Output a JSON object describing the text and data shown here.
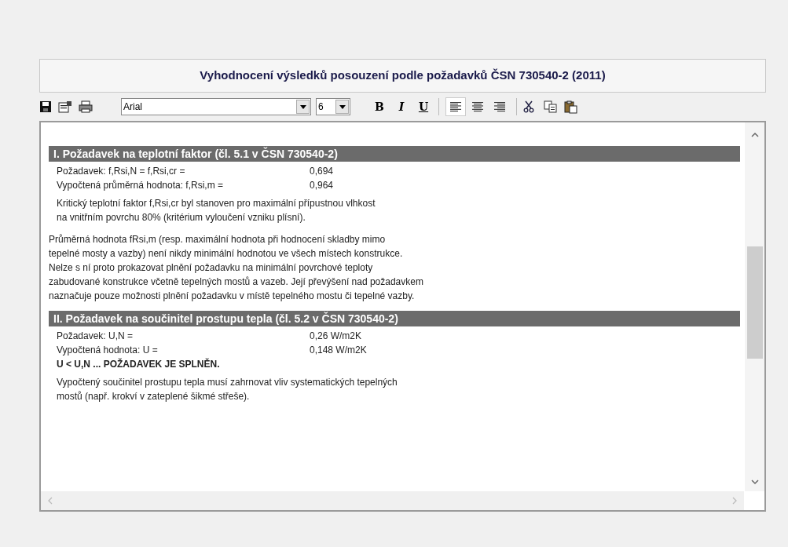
{
  "title": "Vyhodnocení výsledků posouzení podle požadavků ČSN 730540-2 (2011)",
  "toolbar": {
    "font": "Arial",
    "size": "6",
    "formatting": [
      {
        "label": "B",
        "kind": "bold",
        "on": false
      },
      {
        "label": "I",
        "kind": "italic",
        "on": false
      },
      {
        "label": "U",
        "kind": "underline",
        "on": false
      }
    ],
    "alignment": [
      {
        "kind": "left",
        "selected": true
      },
      {
        "kind": "center",
        "selected": false
      },
      {
        "kind": "right",
        "selected": false
      }
    ]
  },
  "document": [
    {
      "kind": "heading",
      "text": "I. Požadavek na teplotní faktor (čl. 5.1 v ČSN 730540-2)"
    },
    {
      "kind": "row",
      "label": "Požadavek: f,Rsi,N = f,Rsi,cr =",
      "value": "0,694"
    },
    {
      "kind": "row",
      "label": "Vypočtená průměrná hodnota: f,Rsi,m =",
      "value": "0,964"
    },
    {
      "kind": "paragraph",
      "indented": true,
      "lines": [
        "Kritický teplotní faktor f,Rsi,cr byl stanoven pro maximální přípustnou vlhkost",
        "na vnitřním povrchu 80% (kritérium vyloučení vzniku plísní)."
      ]
    },
    {
      "kind": "paragraph",
      "indented": false,
      "lines": [
        "Průměrná hodnota fRsi,m (resp. maximální hodnota při hodnocení skladby mimo",
        "tepelné mosty a vazby) není nikdy minimální hodnotou ve všech místech konstrukce.",
        "Nelze s ní proto prokazovat plnění požadavku na minimální povrchové teploty",
        "zabudované konstrukce včetně tepelných mostů a vazeb. Její převýšení nad požadavkem",
        "naznačuje pouze možnosti plnění požadavku v místě tepelného mostu či tepelné vazby."
      ]
    },
    {
      "kind": "heading",
      "text": "II. Požadavek na součinitel prostupu tepla (čl. 5.2 v ČSN 730540-2)"
    },
    {
      "kind": "row",
      "label": "Požadavek: U,N  =",
      "value": "0,26 W/m2K"
    },
    {
      "kind": "row",
      "label": "Vypočtená hodnota: U =",
      "value": "0,148 W/m2K"
    },
    {
      "kind": "verdict",
      "text": "U < U,N ... POŽADAVEK JE SPLNĚN."
    },
    {
      "kind": "paragraph",
      "indented": true,
      "lines": [
        "Vypočtený součinitel prostupu tepla musí zahrnovat vliv systematických tepelných",
        "mostů (např. krokví v zateplené šikmé střeše)."
      ]
    }
  ]
}
